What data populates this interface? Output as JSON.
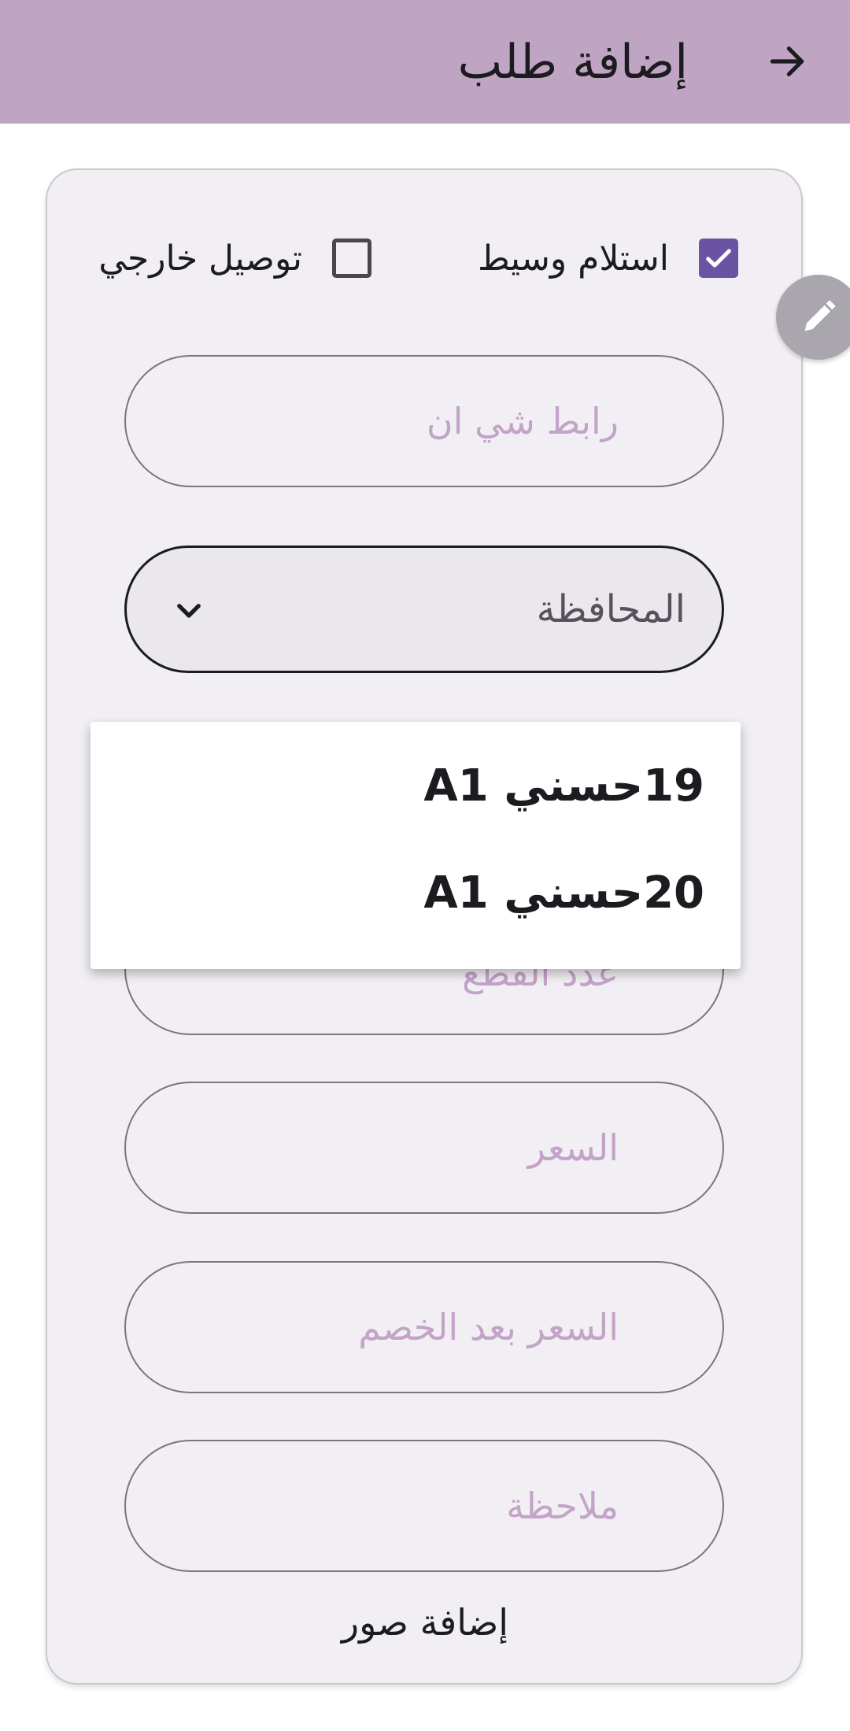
{
  "appbar": {
    "title": "إضافة طلب",
    "back_icon": "arrow-right-icon",
    "background": "#c0a4c3"
  },
  "checkboxes": {
    "receive_via_broker": {
      "label": "استلام وسيط",
      "checked": true
    },
    "external_delivery": {
      "label": "توصيل خارجي",
      "checked": false
    }
  },
  "fab": {
    "icon": "pencil-icon"
  },
  "fields": {
    "shein_link": {
      "placeholder": "رابط شي ان"
    },
    "governorate": {
      "placeholder": "المحافظة"
    },
    "pieces_count": {
      "placeholder": "عدد القطع"
    },
    "price": {
      "placeholder": "السعر"
    },
    "price_after_discount": {
      "placeholder": "السعر بعد الخصم"
    },
    "note": {
      "placeholder": "ملاحظة"
    }
  },
  "dropdown_menu": {
    "items": [
      {
        "label": "19حسني A1"
      },
      {
        "label": "20حسني A1"
      }
    ]
  },
  "add_photos_label": "إضافة صور",
  "colors": {
    "accent": "#6b53a4",
    "card_bg": "#f2eff4",
    "placeholder": "#c4a3c8"
  }
}
